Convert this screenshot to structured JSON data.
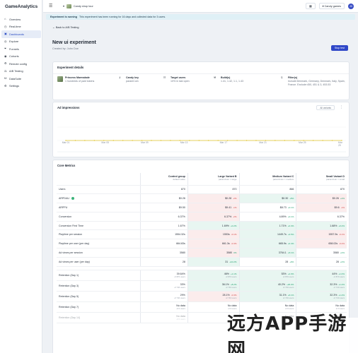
{
  "app": {
    "name": "GameAnalytics"
  },
  "sidebar": {
    "items": [
      {
        "label": "Overview"
      },
      {
        "label": "Real-time"
      },
      {
        "label": "Dashboards"
      },
      {
        "label": "Explore"
      },
      {
        "label": "Funnels"
      },
      {
        "label": "Cohorts"
      },
      {
        "label": "Remote config"
      },
      {
        "label": "A/B Testing"
      },
      {
        "label": "DataSuite"
      },
      {
        "label": "Settings"
      }
    ]
  },
  "topbar": {
    "game": "Candy shop tour",
    "studio": "Candy games",
    "avatar": "JD"
  },
  "banner": {
    "bold": "Experiment is running",
    "text": "This experiment has been running for 16 days and collected data for 3 users."
  },
  "page": {
    "back": "Back to A/B Testing",
    "title": "New ui experiment",
    "subtitle": "Created by: John Doe",
    "stop_button": "Stop test"
  },
  "details": {
    "title": "Experiment details",
    "items": [
      {
        "title": "Princess Marmalade",
        "value": "1 hundreds of paid tokens"
      },
      {
        "title": "Candy key",
        "value": "paramCoin"
      },
      {
        "title": "Target users",
        "value": "10% in last open"
      },
      {
        "title": "Build(s)",
        "value": "1.41, 1.42, 1.1, 1.43"
      },
      {
        "title": "Filter(s)",
        "value": "Include:Denmark, Germany, Denmark, Italy, Spain, France. Exclude:450, 451 & 3, 453.53"
      }
    ]
  },
  "impressions": {
    "title": "Ad impressions",
    "all_variants": "All variants",
    "ticks": [
      "Mar 01",
      "Mar 05",
      "Mar 09",
      "Mar 13",
      "Mar 17",
      "Mar 21",
      "Mar 25",
      "Mar 29"
    ]
  },
  "core": {
    "title": "Core Metrics",
    "headers": [
      {
        "name": "Control group",
        "sub": "default value"
      },
      {
        "name": "Large Variant B",
        "sub": "paramCoin = large"
      },
      {
        "name": "Medium Variant C",
        "sub": "paramCoin = medium"
      },
      {
        "name": "Small Variant D",
        "sub": "paramCoin = small"
      }
    ],
    "rows": [
      {
        "label": "Users",
        "v": [
          "870",
          "870",
          "866",
          "870"
        ],
        "c": [
          "",
          "",
          "",
          ""
        ],
        "s": [
          "n",
          "n",
          "n",
          "n"
        ]
      },
      {
        "label": "ARPDAU",
        "v": [
          "$0.26",
          "$0.28",
          "$0.30",
          "$0.26"
        ],
        "c": [
          "",
          "-2%",
          "+5%",
          "+2%"
        ],
        "s": [
          "n",
          "neg",
          "pos",
          "neg"
        ]
      },
      {
        "label": "ARPPU",
        "v": [
          "$9.50",
          "$9.41",
          "$8.73",
          "$9.6"
        ],
        "c": [
          "",
          "-1%",
          "+0.1%",
          "-1%"
        ],
        "s": [
          "n",
          "neg",
          "n",
          "neg"
        ]
      },
      {
        "label": "Conversion",
        "v": [
          "6.37%",
          "6.37%",
          "4.89%",
          "6.37%"
        ],
        "c": [
          "",
          "-2%",
          "+0.1%",
          ""
        ],
        "s": [
          "n",
          "neg",
          "n",
          "n"
        ]
      },
      {
        "label": "Conversion First Time",
        "v": [
          "1.67%",
          "1.69%",
          "1.71%",
          "1.68%"
        ],
        "c": [
          "",
          "+0.2%",
          "+0.3%",
          "+0.2%"
        ],
        "s": [
          "n",
          "pos",
          "pos",
          "pos"
        ]
      },
      {
        "label": "Playtime per session",
        "v": [
          "1554.32s",
          "1553s",
          "1449.7s",
          "1557.9s"
        ],
        "c": [
          "",
          "-0.1%",
          "+3.5%",
          "-0.1%"
        ],
        "s": [
          "n",
          "neg",
          "pos",
          "neg"
        ]
      },
      {
        "label": "Playtime per user (per day)",
        "v": [
          "664.83s",
          "661.3s",
          "665.9s",
          "658.02s"
        ],
        "c": [
          "",
          "-0.3%",
          "+0.4%",
          "-0.2%"
        ],
        "s": [
          "n",
          "neg",
          "pos",
          "neg"
        ]
      },
      {
        "label": "Ad views per session",
        "v": [
          "3580",
          "3580",
          "3764.1",
          "3580"
        ],
        "c": [
          "",
          "0%",
          "+5.1%",
          "+0%"
        ],
        "s": [
          "n",
          "neg",
          "pos",
          "n"
        ]
      },
      {
        "label": "Ad views per user (per day)",
        "v": [
          "28",
          "31",
          "28",
          "28"
        ],
        "c": [
          "",
          "+10.2%",
          "+0%",
          "+0%"
        ],
        "s": [
          "n",
          "pos",
          "n",
          "n"
        ]
      }
    ],
    "retention": [
      {
        "label": "Retention (Day 1)",
        "v": [
          "39.64%",
          "46%",
          "53%",
          "44%"
        ],
        "c": [
          "",
          "+1.1%",
          "+2.0%",
          "+1.0%"
        ],
        "sub": [
          "of 870 users",
          "of 870 users",
          "of 870 users",
          "of 870 users"
        ],
        "s": [
          "n",
          "pos",
          "pos",
          "pos"
        ]
      },
      {
        "label": "Retention (Day 3)",
        "v": [
          "33%",
          "36.1%",
          "40.2%",
          "32.3%"
        ],
        "c": [
          "",
          "+8.2%",
          "+20.2%",
          "+1.2%"
        ],
        "sub": [
          "of 740 users",
          "of 740 users",
          "of 740 users",
          "of 740 users"
        ],
        "s": [
          "n",
          "pos",
          "pos",
          "pos"
        ]
      },
      {
        "label": "Retention (Day 5)",
        "v": [
          "29%",
          "28.1%",
          "31.1%",
          "32.3%"
        ],
        "c": [
          "",
          "-0.3%",
          "+6.1%",
          "+1.4%"
        ],
        "sub": [
          "of 740 users",
          "of 740 users",
          "of 740 users",
          "of 740 users"
        ],
        "s": [
          "n",
          "neg",
          "pos",
          "pos"
        ]
      },
      {
        "label": "Retention (Day 7)",
        "v": [
          "No data",
          "No data",
          "No data",
          "No data"
        ],
        "c": [
          "",
          "",
          "",
          ""
        ],
        "sub": [
          "of 0 users",
          "of 0 users",
          "of 0 users",
          "of 0 users"
        ],
        "s": [
          "n",
          "n",
          "n",
          "n"
        ]
      },
      {
        "label": "Retention (Day 14)",
        "v": [
          "No data",
          "No data",
          "No data",
          "No data"
        ],
        "c": [
          "",
          "",
          "",
          ""
        ],
        "sub": [
          "of 0 users",
          "of 0 users",
          "of 0 users",
          "of 0 users"
        ],
        "s": [
          "n",
          "n",
          "n",
          "n"
        ]
      }
    ]
  },
  "watermark": "远方APP手游网",
  "colors": {
    "accent": "#2f47c8",
    "positive": "#1b9c6b",
    "negative": "#d04545",
    "line": "#e0c22a"
  }
}
